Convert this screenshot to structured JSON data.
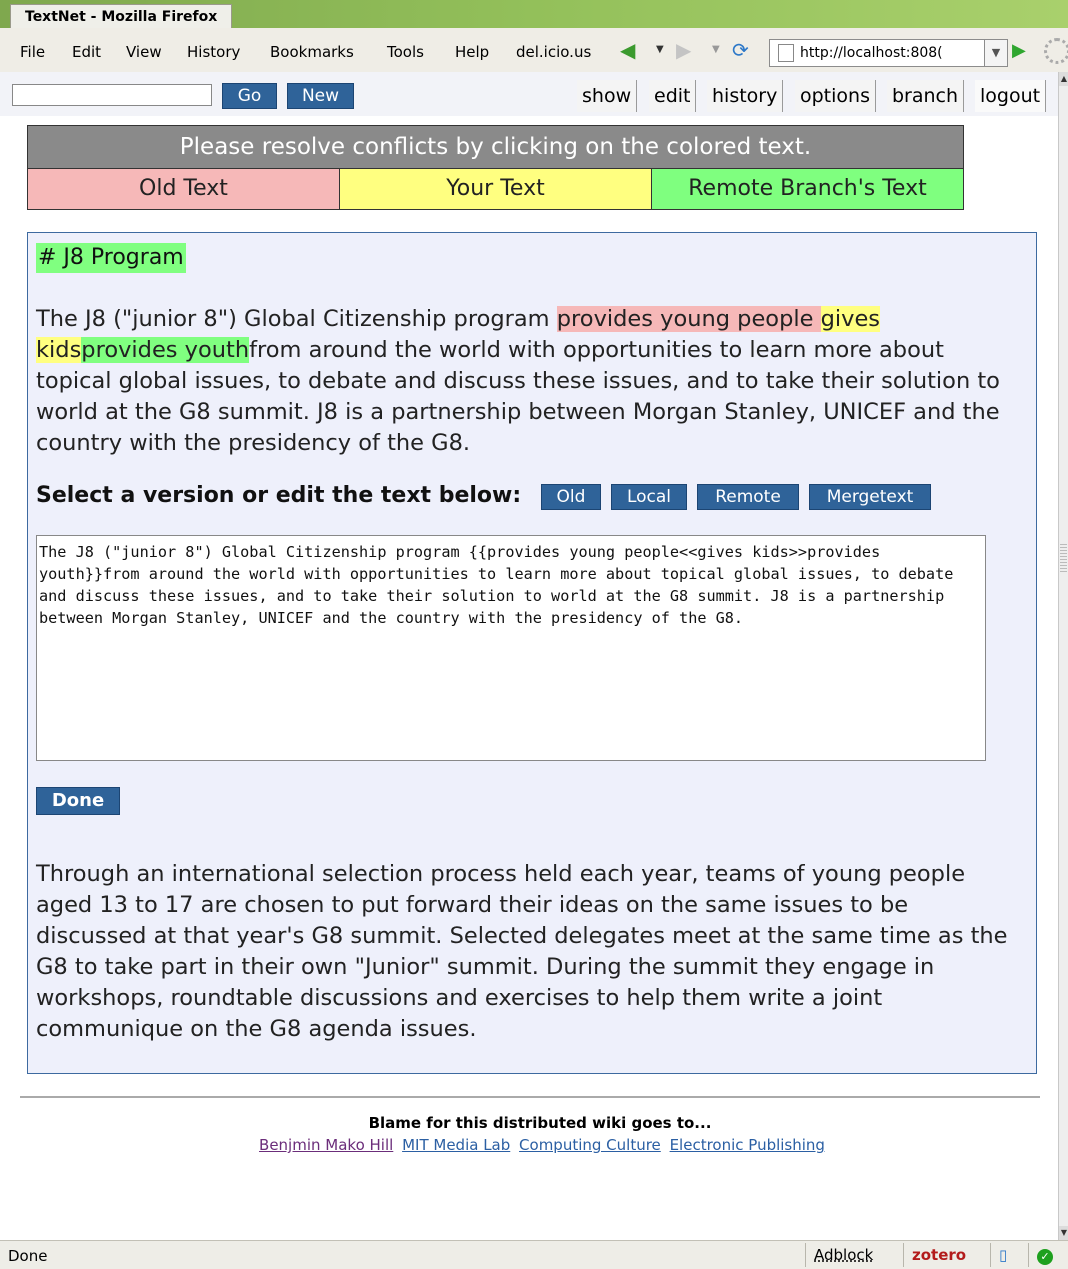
{
  "window": {
    "title": "TextNet - Mozilla Firefox"
  },
  "menu": {
    "file": "File",
    "edit": "Edit",
    "view": "View",
    "history": "History",
    "bookmarks": "Bookmarks",
    "tools": "Tools",
    "help": "Help",
    "delicious": "del.icio.us"
  },
  "url": {
    "value": "http://localhost:808("
  },
  "toolbar": {
    "go": "Go",
    "new": "New"
  },
  "tabs": [
    "show",
    "edit",
    "history",
    "options",
    "branch",
    "logout"
  ],
  "conflict": {
    "header": "Please resolve conflicts by clicking on the colored text.",
    "old": "Old Text",
    "yours": "Your Text",
    "remote": "Remote Branch's Text"
  },
  "doc": {
    "heading": "# J8 Program",
    "p1_start": "The J8 (\"junior 8\") Global Citizenship program ",
    "p1_old": "provides young people ",
    "p1_yours": "gives kids",
    "p1_remote": "provides youth",
    "p1_rest": "from around the world with opportunities to learn more about topical global issues, to debate and discuss these issues, and to take their solution to world at the G8 summit. J8 is a partnership between Morgan Stanley, UNICEF and the country with the presidency of the G8.",
    "select_label": "Select a version or edit the text below:",
    "buttons": {
      "old": "Old",
      "local": "Local",
      "remote": "Remote",
      "mergetext": "Mergetext"
    },
    "editor_text": "The J8 (\"junior 8\") Global Citizenship program {{provides young people<<gives kids>>provides youth}}from around the world with opportunities to learn more about topical global issues, to debate and discuss these issues, and to take their solution to world at the G8 summit. J8 is a partnership between Morgan Stanley, UNICEF and the country with the presidency of the G8.",
    "done": "Done",
    "p2": "Through an international selection process held each year, teams of young people aged 13 to 17 are chosen to put forward their ideas on the same issues to be discussed at that year's G8 summit. Selected delegates meet at the same time as the G8 to take part in their own \"Junior\" summit. During the summit they engage in workshops, roundtable discussions and exercises to help them write a joint communique on the G8 agenda issues."
  },
  "footer": {
    "blame": "Blame for this distributed wiki goes to...",
    "links": [
      "Benjmin Mako Hill",
      "MIT Media Lab",
      "Computing Culture",
      "Electronic Publishing"
    ]
  },
  "status": {
    "text": "Done",
    "adblock": "Adblock",
    "zotero": "zotero"
  },
  "colors": {
    "old": "#f6b8b8",
    "yours": "#ffff80",
    "remote": "#80ff80",
    "button": "#2f6399"
  }
}
